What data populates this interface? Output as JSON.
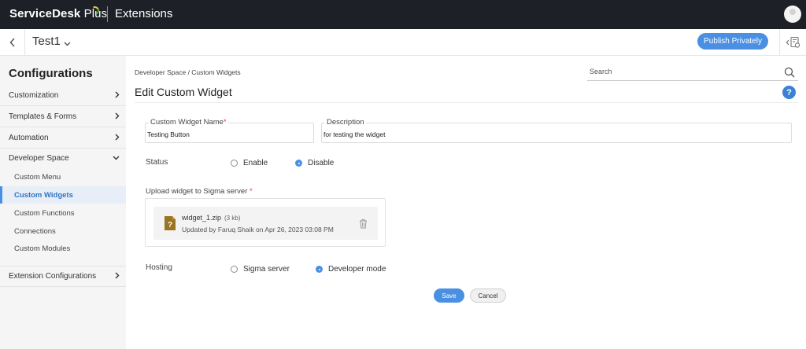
{
  "topbar": {
    "brand": "ServiceDesk",
    "brand_plus": "Plus",
    "module": "Extensions",
    "avatar_icon": "user-avatar-icon"
  },
  "subbar": {
    "app_name": "Test1",
    "publish_label": "Publish Privately"
  },
  "sidebar": {
    "heading": "Configurations",
    "sections": [
      {
        "label": "Customization"
      },
      {
        "label": "Templates & Forms"
      },
      {
        "label": "Automation"
      },
      {
        "label": "Developer Space"
      }
    ],
    "dev_items": [
      {
        "label": "Custom Menu"
      },
      {
        "label": "Custom Widgets"
      },
      {
        "label": "Custom Functions"
      },
      {
        "label": "Connections"
      },
      {
        "label": "Custom Modules"
      }
    ],
    "extension_config": "Extension Configurations"
  },
  "main": {
    "breadcrumb": "Developer Space / Custom Widgets",
    "search_placeholder": "Search",
    "title": "Edit Custom Widget",
    "help": "?",
    "form": {
      "name_label": "Custom Widget Name",
      "name_value": "Testing Button",
      "desc_label": "Description",
      "desc_value": "for testing the widget",
      "required_mark": "*",
      "status_label": "Status",
      "status_options": [
        "Enable",
        "Disable"
      ],
      "status_selected": "Disable",
      "upload_label": "Upload widget to Sigma server",
      "file_name": "widget_1.zip",
      "file_size": "(3 kb)",
      "file_updated": "Updated by Faruq Shaik on Apr 26, 2023 03:08 PM",
      "hosting_label": "Hosting",
      "hosting_options": [
        "Sigma server",
        "Developer mode"
      ],
      "hosting_selected": "Developer mode",
      "save": "Save",
      "cancel": "Cancel"
    }
  },
  "colors": {
    "topbar": "#1d2127",
    "accent": "#4a90e2",
    "sidebar_bg": "#f5f5f5",
    "required": "#e03a3a"
  }
}
